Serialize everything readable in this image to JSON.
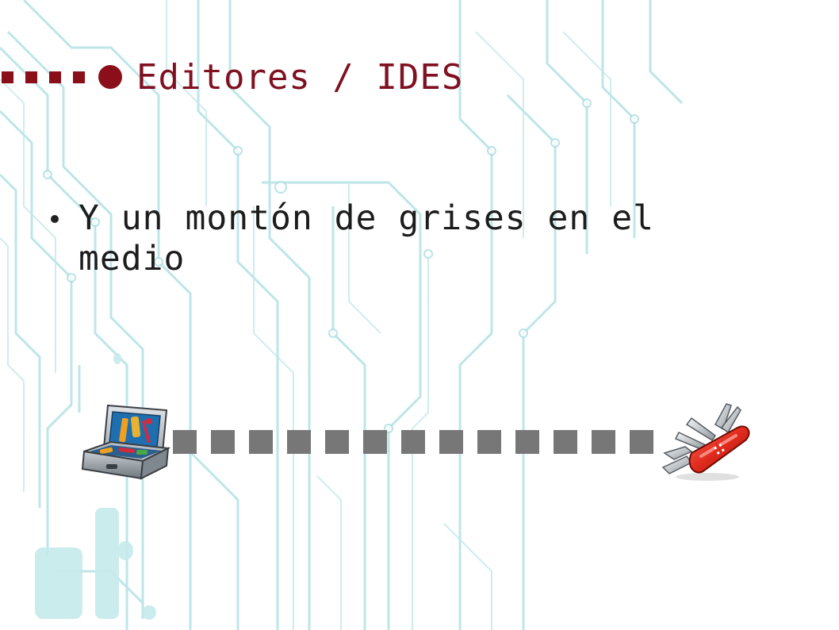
{
  "slide": {
    "title": "Editores / IDES",
    "bullets": [
      {
        "text": "Y un montón de grises en el medio"
      }
    ],
    "scale": {
      "left_icon": "toolbox-icon",
      "right_icon": "swiss-army-knife-icon",
      "step_count": 13,
      "step_color": "#777777"
    },
    "colors": {
      "accent": "#8a0f1a",
      "title": "#7f1120",
      "text": "#1c1c1c",
      "circuit": "#9ed7dc",
      "background": "#ffffff"
    },
    "background_motif": "circuit-board-pattern"
  }
}
